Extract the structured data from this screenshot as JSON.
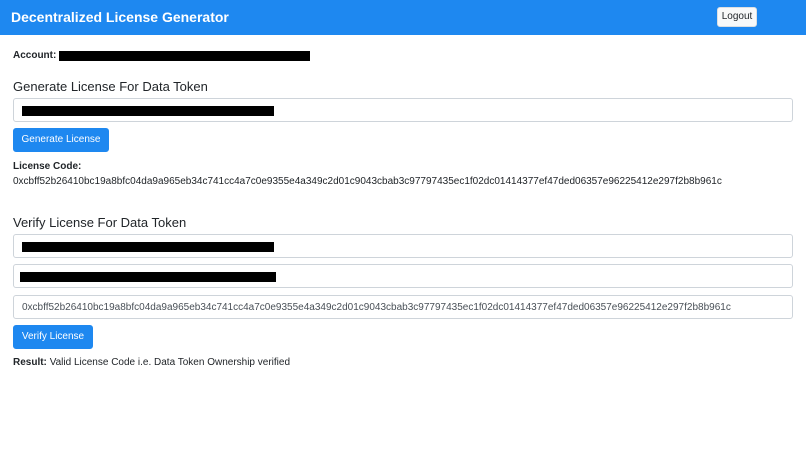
{
  "navbar": {
    "brand": "Decentralized License Generator",
    "logout_label": "Logout"
  },
  "account": {
    "label": "Account:"
  },
  "generate": {
    "title": "Generate License For Data Token",
    "button_label": "Generate License",
    "code_label": "License Code:",
    "code_value": "0xcbff52b26410bc19a8bfc04da9a965eb34c741cc4a7c0e9355e4a349c2d01c9043cbab3c97797435ec1f02dc01414377ef47ded06357e96225412e297f2b8b961c"
  },
  "verify": {
    "title": "Verify License For Data Token",
    "license_code_value": "0xcbff52b26410bc19a8bfc04da9a965eb34c741cc4a7c0e9355e4a349c2d01c9043cbab3c97797435ec1f02dc01414377ef47ded06357e96225412e297f2b8b961c",
    "button_label": "Verify License",
    "result_label": "Result:",
    "result_value": "Valid License Code i.e. Data Token Ownership verified"
  },
  "colors": {
    "primary": "#1e88f0",
    "redaction": "#000000"
  }
}
